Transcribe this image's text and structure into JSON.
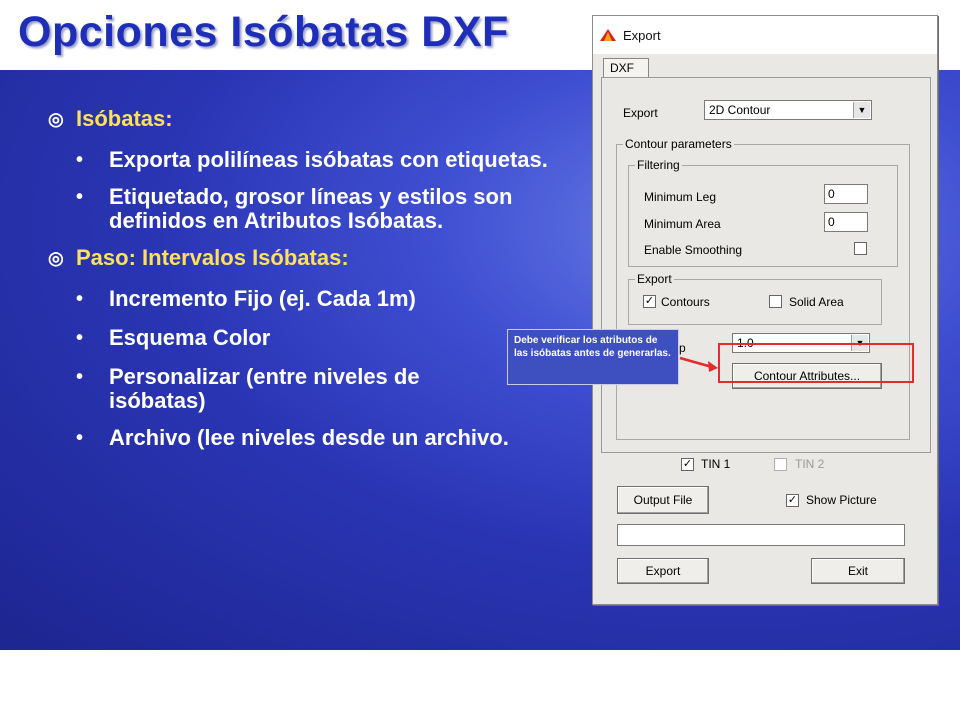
{
  "slide": {
    "title": "Opciones Isóbatas DXF",
    "sections": [
      {
        "heading": "Isóbatas:",
        "items": [
          "Exporta polilíneas isóbatas con etiquetas.",
          "Etiquetado, grosor líneas y estilos son definidos en Atributos Isóbatas."
        ]
      },
      {
        "heading": "Paso:  Intervalos Isóbatas:",
        "items": [
          "Incremento Fijo (ej. Cada 1m)",
          "Esquema Color",
          "Personalizar (entre niveles de isóbatas)",
          "Archivo (lee niveles desde un archivo."
        ]
      }
    ],
    "callout_text": "Debe verificar los atributos de las isóbatas antes de generarlas."
  },
  "dialog": {
    "title": "Export",
    "tab": "DXF",
    "export_label": "Export",
    "export_value": "2D Contour",
    "contour_parameters": "Contour parameters",
    "filtering": "Filtering",
    "minimum_leg_label": "Minimum Leg",
    "minimum_leg_value": "0",
    "minimum_area_label": "Minimum Area",
    "minimum_area_value": "0",
    "enable_smoothing_label": "Enable Smoothing",
    "export_group": "Export",
    "contours_label": "Contours",
    "solid_area_label": "Solid Area",
    "step_label": "Step",
    "step_value": "1.0",
    "contour_attributes_button": "Contour Attributes...",
    "tin1_label": "TIN 1",
    "tin2_label": "TIN 2",
    "output_file_button": "Output File",
    "show_picture_label": "Show Picture",
    "export_button": "Export",
    "exit_button": "Exit",
    "check_mark": "✓"
  },
  "colors": {
    "title": "#1e2eb8",
    "heading": "#ffe05a",
    "highlight": "#e52b2b"
  }
}
